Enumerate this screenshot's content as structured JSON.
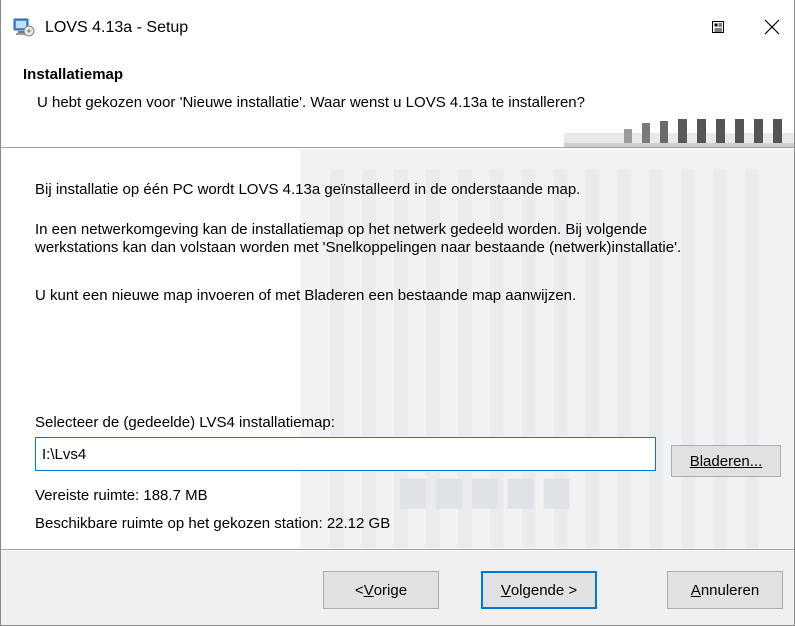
{
  "window": {
    "title": "LOVS 4.13a - Setup",
    "app_icon": "setup-computer-icon",
    "options_icon": "window-options-icon",
    "close_glyph": "✕"
  },
  "header": {
    "title": "Installatiemap",
    "subtitle": "U hebt gekozen voor 'Nieuwe installatie'. Waar wenst u LOVS 4.13a te installeren?"
  },
  "content": {
    "paragraph1": "Bij installatie op één PC wordt LOVS 4.13a geïnstalleerd in de onderstaande map.",
    "paragraph2_line1": "In een netwerkomgeving kan de installatiemap op het netwerk gedeeld worden. Bij volgende",
    "paragraph2_line2": "werkstations kan dan volstaan worden met 'Snelkoppelingen naar bestaande (netwerk)installatie'.",
    "paragraph3": "U kunt een nieuwe map invoeren of met Bladeren een bestaande map aanwijzen.",
    "select_label": "Selecteer de (gedeelde) LVS4 installatiemap:",
    "path_value": "I:\\Lvs4",
    "browse_label": "Bladeren...",
    "required_space": "Vereiste ruimte: 188.7 MB",
    "available_space": "Beschikbare ruimte op het gekozen station: 22.12 GB"
  },
  "footer": {
    "prev_prefix": "< ",
    "prev_mnemonic": "V",
    "prev_rest": "orige",
    "next_mnemonic": "V",
    "next_rest": "olgende >",
    "cancel_mnemonic": "A",
    "cancel_rest": "nnuleren"
  },
  "colors": {
    "accent": "#0078d7",
    "button_face": "#e1e1e1",
    "dialog_bg": "#f0f0f0"
  }
}
